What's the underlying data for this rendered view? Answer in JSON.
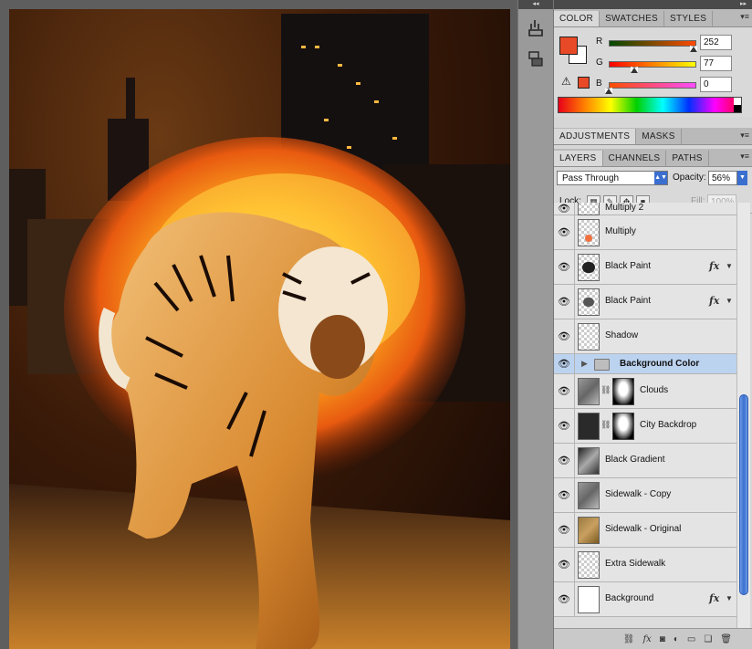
{
  "color_panel": {
    "tabs": [
      "COLOR",
      "SWATCHES",
      "STYLES"
    ],
    "active_tab": "COLOR",
    "fg_color": "#e84a28",
    "bg_color": "#ffffff",
    "r_label": "R",
    "r_value": "252",
    "g_label": "G",
    "g_value": "77",
    "b_label": "B",
    "b_value": "0",
    "r_fraction": 0.988,
    "g_fraction": 0.302,
    "b_fraction": 0.0
  },
  "adjustments": {
    "tabs": [
      "ADJUSTMENTS",
      "MASKS"
    ]
  },
  "layers_panel": {
    "tabs": [
      "LAYERS",
      "CHANNELS",
      "PATHS"
    ],
    "blend_mode": "Pass Through",
    "opacity_label": "Opacity:",
    "opacity_value": "56%",
    "lock_label": "Lock:",
    "fill_label": "Fill:",
    "fill_value": "100%",
    "partial_top_label": "Multiply 2",
    "layers": [
      {
        "name": "Multiply",
        "thumb": "checker-orange",
        "fx": false
      },
      {
        "name": "Black Paint",
        "thumb": "checker-splat",
        "fx": true
      },
      {
        "name": "Black Paint",
        "thumb": "checker-splat",
        "fx": true
      },
      {
        "name": "Shadow",
        "thumb": "checker",
        "fx": false
      },
      {
        "name": "Background Color",
        "group": true,
        "selected": true
      },
      {
        "name": "Clouds",
        "thumb": "stone",
        "mask": true
      },
      {
        "name": "City Backdrop",
        "thumb": "dark",
        "mask": true
      },
      {
        "name": "Black Gradient",
        "thumb": "grad"
      },
      {
        "name": "Sidewalk - Copy",
        "thumb": "stone"
      },
      {
        "name": "Sidewalk - Original",
        "thumb": "tan"
      },
      {
        "name": "Extra Sidewalk",
        "thumb": "checker"
      },
      {
        "name": "Background",
        "thumb": "white",
        "fx": true
      }
    ]
  },
  "icons": {
    "eye": "eye-icon",
    "fx": "fx-icon",
    "link": "link-icon",
    "trash": "trash-icon",
    "folder": "folder-icon"
  },
  "fx_text": "fx"
}
